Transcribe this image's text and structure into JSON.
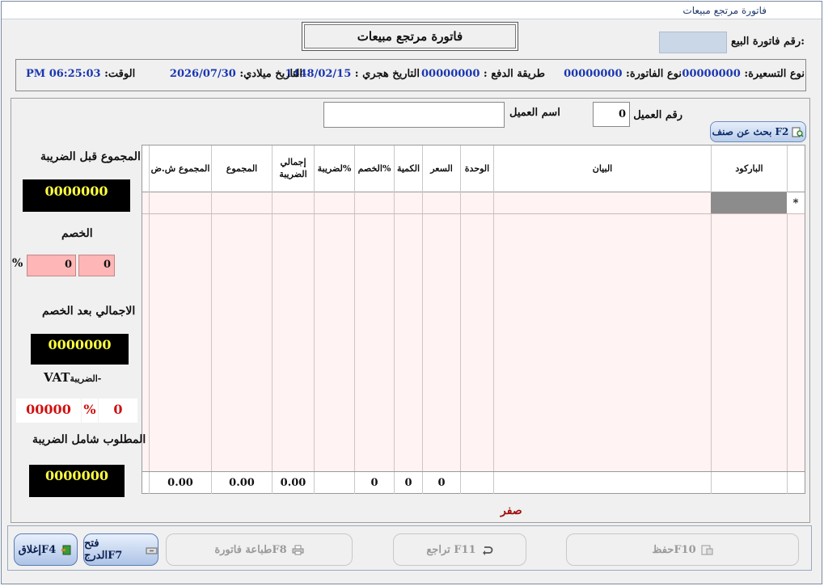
{
  "window": {
    "title": "فاتورة مرتجع مبيعات"
  },
  "header": {
    "main_title": "فاتورة مرتجع مبيعات",
    "sale_invoice_label": "رقم فاتورة البيع:"
  },
  "info": {
    "pricing_type_label": "نوع التسعيرة:",
    "pricing_type_value": "00000000",
    "invoice_type_label": "نوع الفاتورة:",
    "invoice_type_value": "00000000",
    "payment_method_label": "طريقة الدفع :",
    "payment_method_value": "00000000",
    "hijri_date_label": "التاريخ هجري :",
    "hijri_date_value": "1448/02/15",
    "gregorian_date_label": "التاريخ ميلادي:",
    "gregorian_date_value": "2026/07/30",
    "time_label": "الوقت:",
    "time_value": "06:25:03 PM"
  },
  "customer": {
    "number_label": "رقم العميل",
    "number_value": "0",
    "name_label": "اسم العميل",
    "name_value": ""
  },
  "search_button": {
    "label": "بحث عن صنف",
    "key": "F2"
  },
  "grid": {
    "columns": {
      "barcode": "الباركود",
      "description": "البيان",
      "unit": "الوحدة",
      "price": "السعر",
      "quantity": "الكمية",
      "discount_pct": "الخصم%",
      "tax_pct": "لضريبة%",
      "tax_total_line1": "إجمالي",
      "tax_total_line2": "الضريبة",
      "total": "المجموع",
      "total_excl": "المجموع ش.ض"
    },
    "new_row_marker": "*",
    "footer": {
      "price": "0",
      "quantity": "0",
      "discount": "0",
      "tax_total": "0.00",
      "total": "0.00",
      "total_excl": "0.00"
    }
  },
  "summary": {
    "pre_tax_label": "المجموع قبل الضريبة",
    "pre_tax_value": "0000000",
    "discount_label": "الخصم",
    "discount_value": "0",
    "discount_pct_value": "0",
    "discount_pct_symbol": "%",
    "after_discount_label": "الاجمالي بعد الخصم",
    "after_discount_value": "0000000",
    "vat_label": "VAT",
    "vat_label_ar": "الضريبة-",
    "vat_value": "0",
    "vat_pct_symbol": "%",
    "vat_amount_value": "00000",
    "grand_total_label": "المطلوب شامل الضريبة",
    "grand_total_value": "0000000"
  },
  "amount_in_words": "صفر",
  "toolbar": {
    "save": "حفظF10",
    "undo": "تراجع F11",
    "print": "طباعة فاتورةF8",
    "open_drawer": "فتح الدرجF7",
    "close": "إغلاقF4"
  },
  "colors": {
    "value_blue": "#1a36b0",
    "summary_yellow": "#ffff40",
    "alert_red": "#d01010",
    "grid_pink": "#fff3f3"
  }
}
